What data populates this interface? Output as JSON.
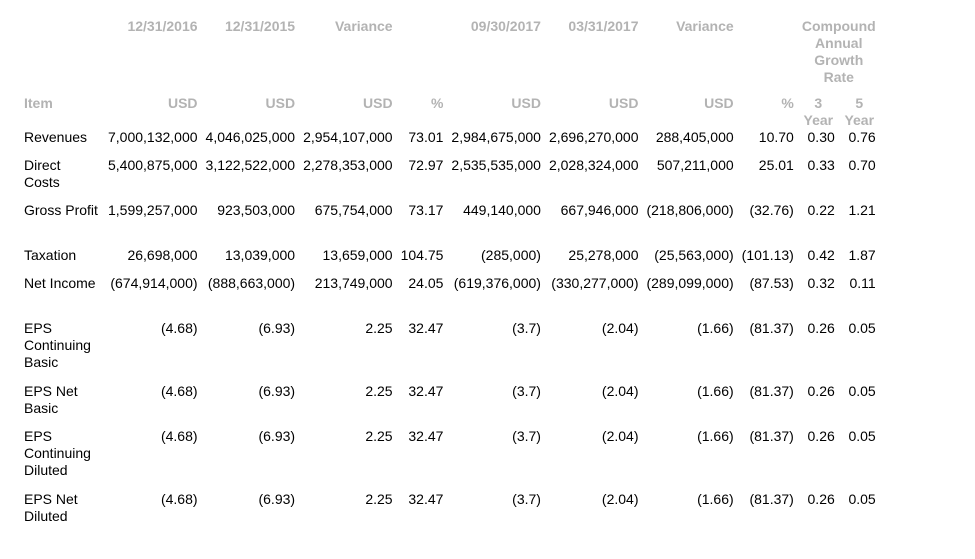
{
  "header": {
    "periods": [
      "12/31/2016",
      "12/31/2015",
      "Variance",
      "",
      "09/30/2017",
      "03/31/2017",
      "Variance",
      ""
    ],
    "cagr_label": "Compound Annual Growth Rate",
    "item_label": "Item",
    "units": [
      "USD",
      "USD",
      "USD",
      "%",
      "USD",
      "USD",
      "USD",
      "%"
    ],
    "cagr_3": "3 Year",
    "cagr_5": "5 Year"
  },
  "rows": [
    {
      "label": "Revenues",
      "values": [
        "7,000,132,000",
        "4,046,025,000",
        "2,954,107,000",
        "73.01",
        "2,984,675,000",
        "2,696,270,000",
        "288,405,000",
        "10.70",
        "0.30",
        "0.76"
      ]
    },
    {
      "label": "Direct Costs",
      "values": [
        "5,400,875,000",
        "3,122,522,000",
        "2,278,353,000",
        "72.97",
        "2,535,535,000",
        "2,028,324,000",
        "507,211,000",
        "25.01",
        "0.33",
        "0.70"
      ]
    },
    {
      "label": "Gross Profit",
      "values": [
        "1,599,257,000",
        "923,503,000",
        "675,754,000",
        "73.17",
        "449,140,000",
        "667,946,000",
        "(218,806,000)",
        "(32.76)",
        "0.22",
        "1.21"
      ]
    },
    {
      "label": "Taxation",
      "values": [
        "26,698,000",
        "13,039,000",
        "13,659,000",
        "104.75",
        "(285,000)",
        "25,278,000",
        "(25,563,000)",
        "(101.13)",
        "0.42",
        "1.87"
      ]
    },
    {
      "label": "Net Income",
      "values": [
        "(674,914,000)",
        "(888,663,000)",
        "213,749,000",
        "24.05",
        "(619,376,000)",
        "(330,277,000)",
        "(289,099,000)",
        "(87.53)",
        "0.32",
        "0.11"
      ]
    },
    {
      "label": "EPS Continuing Basic",
      "values": [
        "(4.68)",
        "(6.93)",
        "2.25",
        "32.47",
        "(3.7)",
        "(2.04)",
        "(1.66)",
        "(81.37)",
        "0.26",
        "0.05"
      ]
    },
    {
      "label": "EPS Net Basic",
      "values": [
        "(4.68)",
        "(6.93)",
        "2.25",
        "32.47",
        "(3.7)",
        "(2.04)",
        "(1.66)",
        "(81.37)",
        "0.26",
        "0.05"
      ]
    },
    {
      "label": "EPS Continuing Diluted",
      "values": [
        "(4.68)",
        "(6.93)",
        "2.25",
        "32.47",
        "(3.7)",
        "(2.04)",
        "(1.66)",
        "(81.37)",
        "0.26",
        "0.05"
      ]
    },
    {
      "label": "EPS Net Diluted",
      "values": [
        "(4.68)",
        "(6.93)",
        "2.25",
        "32.47",
        "(3.7)",
        "(2.04)",
        "(1.66)",
        "(81.37)",
        "0.26",
        "0.05"
      ]
    }
  ]
}
